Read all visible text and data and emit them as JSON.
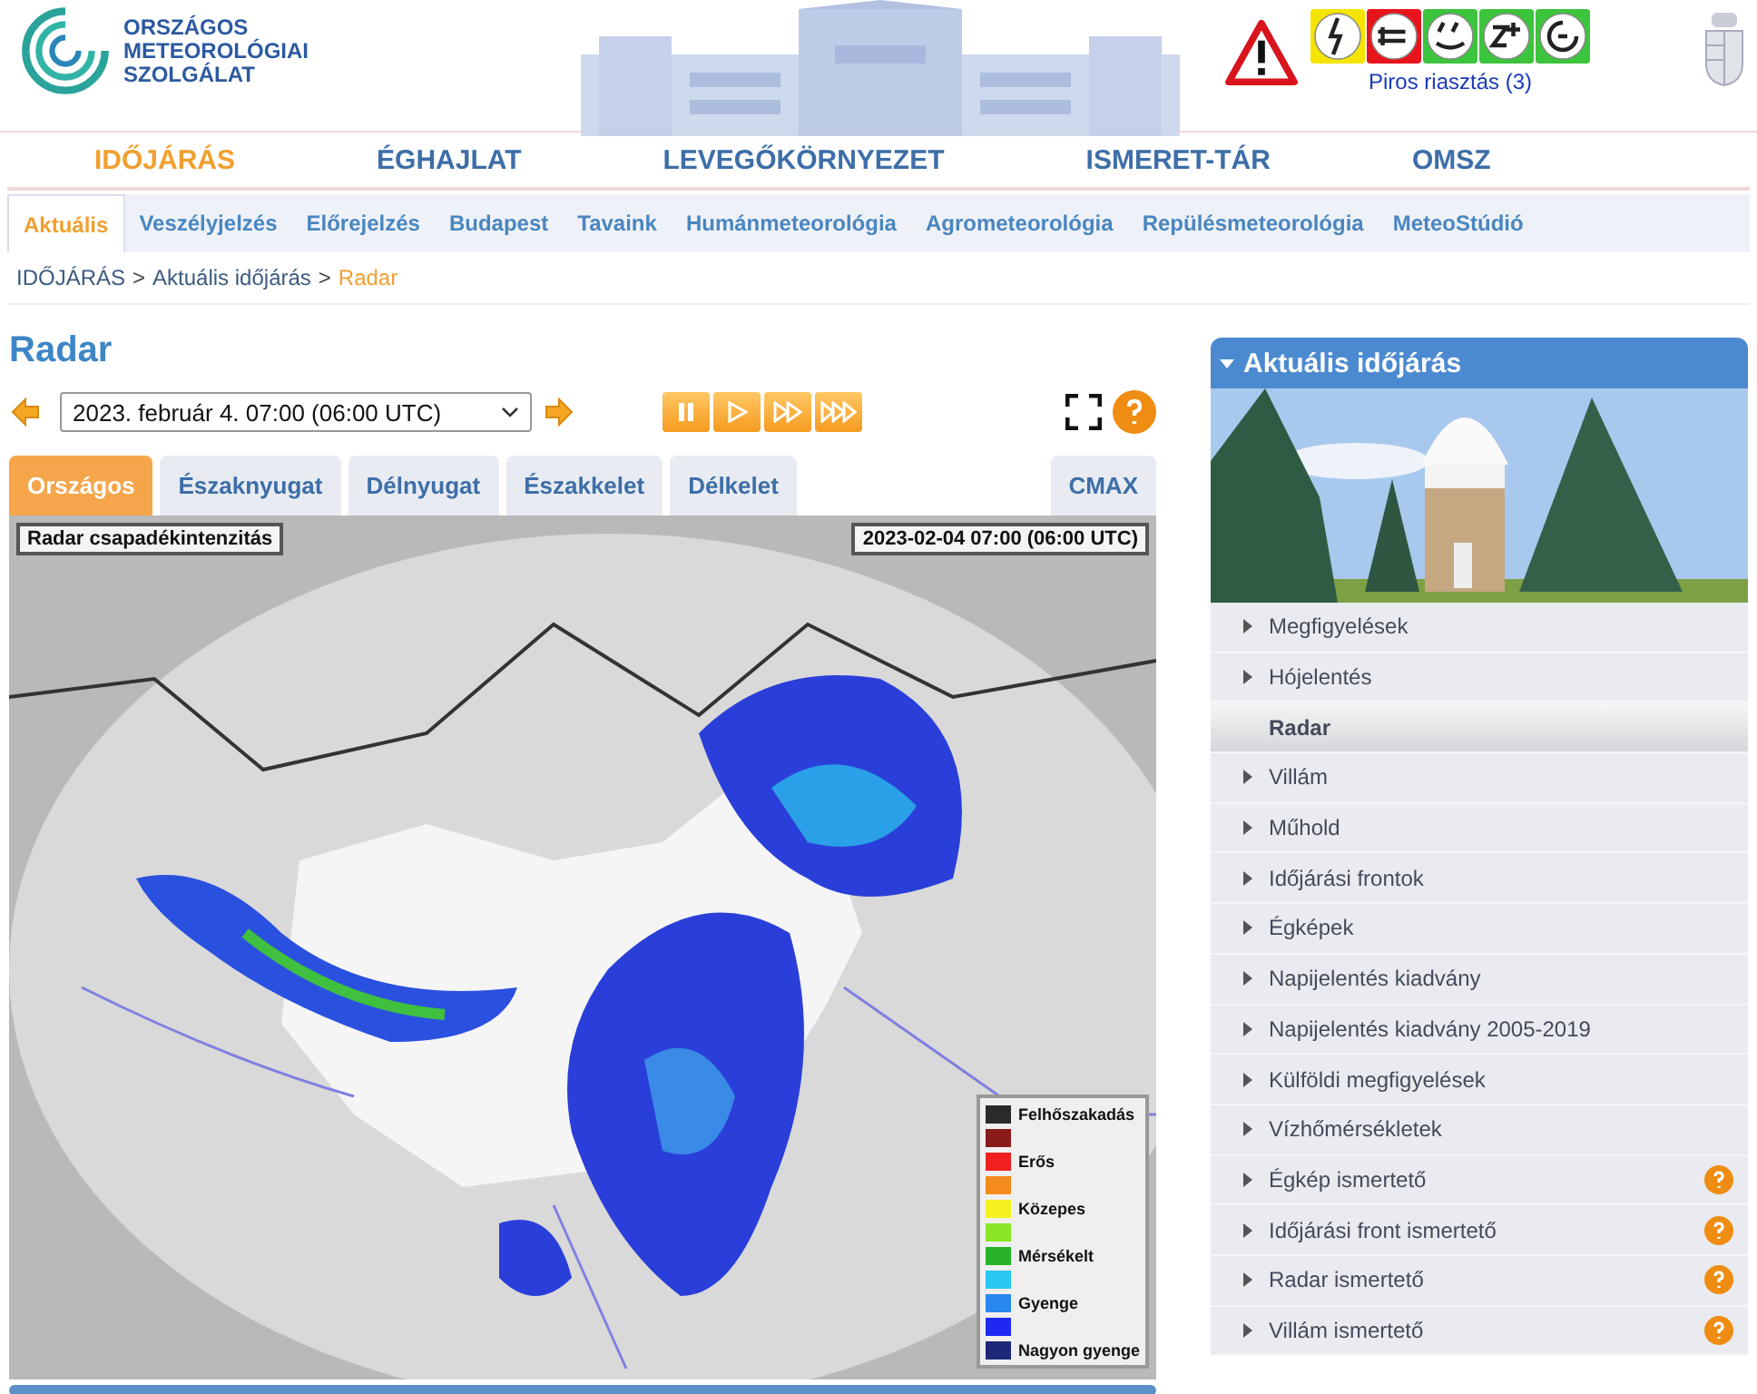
{
  "header": {
    "logo_lines": [
      "ORSZÁGOS",
      "METEOROLÓGIAI",
      "SZOLGÁLAT"
    ],
    "warnings": [
      {
        "kind": "lightning",
        "color": "#f5e400"
      },
      {
        "kind": "wind",
        "color": "#e8141c"
      },
      {
        "kind": "rain",
        "color": "#3cc43c"
      },
      {
        "kind": "snow",
        "color": "#3cc43c"
      },
      {
        "kind": "fog",
        "color": "#3cc43c"
      }
    ],
    "alert_link": "Piros riasztás (3)"
  },
  "main_nav": [
    {
      "label": "IDŐJÁRÁS",
      "selected": true
    },
    {
      "label": "ÉGHAJLAT",
      "selected": false
    },
    {
      "label": "LEVEGŐKÖRNYEZET",
      "selected": false
    },
    {
      "label": "ISMERET-TÁR",
      "selected": false
    },
    {
      "label": "OMSZ",
      "selected": false
    }
  ],
  "sub_nav": [
    {
      "label": "Aktuális",
      "selected": true
    },
    {
      "label": "Veszélyjelzés",
      "selected": false
    },
    {
      "label": "Előrejelzés",
      "selected": false
    },
    {
      "label": "Budapest",
      "selected": false
    },
    {
      "label": "Tavaink",
      "selected": false
    },
    {
      "label": "Humánmeteorológia",
      "selected": false
    },
    {
      "label": "Agrometeorológia",
      "selected": false
    },
    {
      "label": "Repülésmeteorológia",
      "selected": false
    },
    {
      "label": "MeteoStúdió",
      "selected": false
    }
  ],
  "breadcrumb": [
    {
      "label": "IDŐJÁRÁS",
      "current": false
    },
    {
      "separator": ">"
    },
    {
      "label": "Aktuális időjárás",
      "current": false
    },
    {
      "separator": ">"
    },
    {
      "label": "Radar",
      "current": true
    }
  ],
  "page_title": "Radar",
  "time_select": {
    "value": "2023. február 4. 07:00 (06:00  UTC)"
  },
  "region_tabs": [
    {
      "label": "Országos",
      "selected": true
    },
    {
      "label": "Északnyugat",
      "selected": false
    },
    {
      "label": "Délnyugat",
      "selected": false
    },
    {
      "label": "Északkelet",
      "selected": false
    },
    {
      "label": "Délkelet",
      "selected": false
    },
    {
      "label": "CMAX",
      "selected": false
    }
  ],
  "map": {
    "title": "Radar csapadékintenzitás",
    "timestamp": "2023-02-04 07:00 (06:00 UTC)",
    "legend": [
      {
        "label": "Felhőszakadás",
        "color": "#2a2a2a"
      },
      {
        "color": "#8b1a1a"
      },
      {
        "label": "Erős",
        "color": "#f02020"
      },
      {
        "color": "#f58a1e"
      },
      {
        "label": "Közepes",
        "color": "#f5f020"
      },
      {
        "color": "#8ce628"
      },
      {
        "label": "Mérsékelt",
        "color": "#28b428"
      },
      {
        "color": "#28c8f0"
      },
      {
        "label": "Gyenge",
        "color": "#2888f0"
      },
      {
        "color": "#1e28f0"
      },
      {
        "label": "Nagyon gyenge",
        "color": "#1e2878"
      }
    ]
  },
  "sidebar": {
    "title": "Aktuális időjárás",
    "items": [
      {
        "label": "Megfigyelések",
        "selected": false,
        "help": false
      },
      {
        "label": "Hójelentés",
        "selected": false,
        "help": false
      },
      {
        "label": "Radar",
        "selected": true,
        "help": false
      },
      {
        "label": "Villám",
        "selected": false,
        "help": false
      },
      {
        "label": "Műhold",
        "selected": false,
        "help": false
      },
      {
        "label": "Időjárási frontok",
        "selected": false,
        "help": false
      },
      {
        "label": "Égképek",
        "selected": false,
        "help": false
      },
      {
        "label": "Napijelentés kiadvány",
        "selected": false,
        "help": false
      },
      {
        "label": "Napijelentés kiadvány 2005-2019",
        "selected": false,
        "help": false
      },
      {
        "label": "Külföldi megfigyelések",
        "selected": false,
        "help": false
      },
      {
        "label": "Vízhőmérsékletek",
        "selected": false,
        "help": false
      },
      {
        "label": "Égkép ismertető",
        "selected": false,
        "help": true
      },
      {
        "label": "Időjárási front ismertető",
        "selected": false,
        "help": true
      },
      {
        "label": "Radar ismertető",
        "selected": false,
        "help": true
      },
      {
        "label": "Villám ismertető",
        "selected": false,
        "help": true
      }
    ]
  }
}
